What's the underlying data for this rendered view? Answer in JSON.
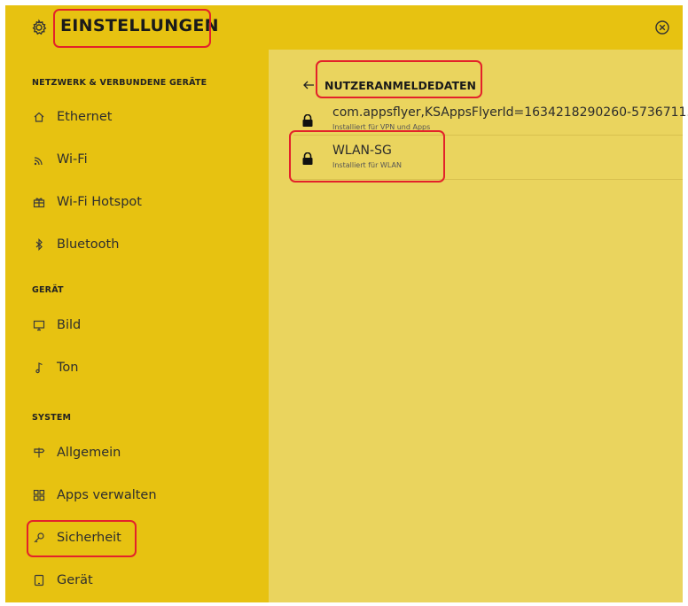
{
  "header": {
    "title": "EINSTELLUNGEN",
    "settings_icon": "gear-icon",
    "close_icon": "close-circle-icon"
  },
  "sidebar": {
    "sections": [
      {
        "title": "NETZWERK & VERBUNDENE GERÄTE",
        "items": [
          {
            "label": "Ethernet",
            "icon": "home-icon"
          },
          {
            "label": "Wi-Fi",
            "icon": "wifi-icon"
          },
          {
            "label": "Wi-Fi Hotspot",
            "icon": "hotspot-icon"
          },
          {
            "label": "Bluetooth",
            "icon": "bluetooth-icon"
          }
        ]
      },
      {
        "title": "GERÄT",
        "items": [
          {
            "label": "Bild",
            "icon": "monitor-icon"
          },
          {
            "label": "Ton",
            "icon": "music-note-icon"
          }
        ]
      },
      {
        "title": "SYSTEM",
        "items": [
          {
            "label": "Allgemein",
            "icon": "signpost-icon"
          },
          {
            "label": "Apps verwalten",
            "icon": "apps-grid-icon"
          },
          {
            "label": "Sicherheit",
            "icon": "key-icon"
          },
          {
            "label": "Gerät",
            "icon": "device-icon"
          }
        ]
      }
    ]
  },
  "content": {
    "back_icon": "arrow-left-icon",
    "title": "NUTZERANMELDEDATEN",
    "credentials": [
      {
        "name": "com.appsflyer,KSAppsFlyerId=1634218290260-5736711...",
        "subtitle": "Installiert für VPN und Apps",
        "icon": "lock-icon"
      },
      {
        "name": "WLAN-SG",
        "subtitle": "Installiert für WLAN",
        "icon": "lock-icon"
      }
    ]
  },
  "colors": {
    "sidebar_bg": "#e7c211",
    "content_bg": "#ead45e",
    "highlight": "#e3222a"
  }
}
